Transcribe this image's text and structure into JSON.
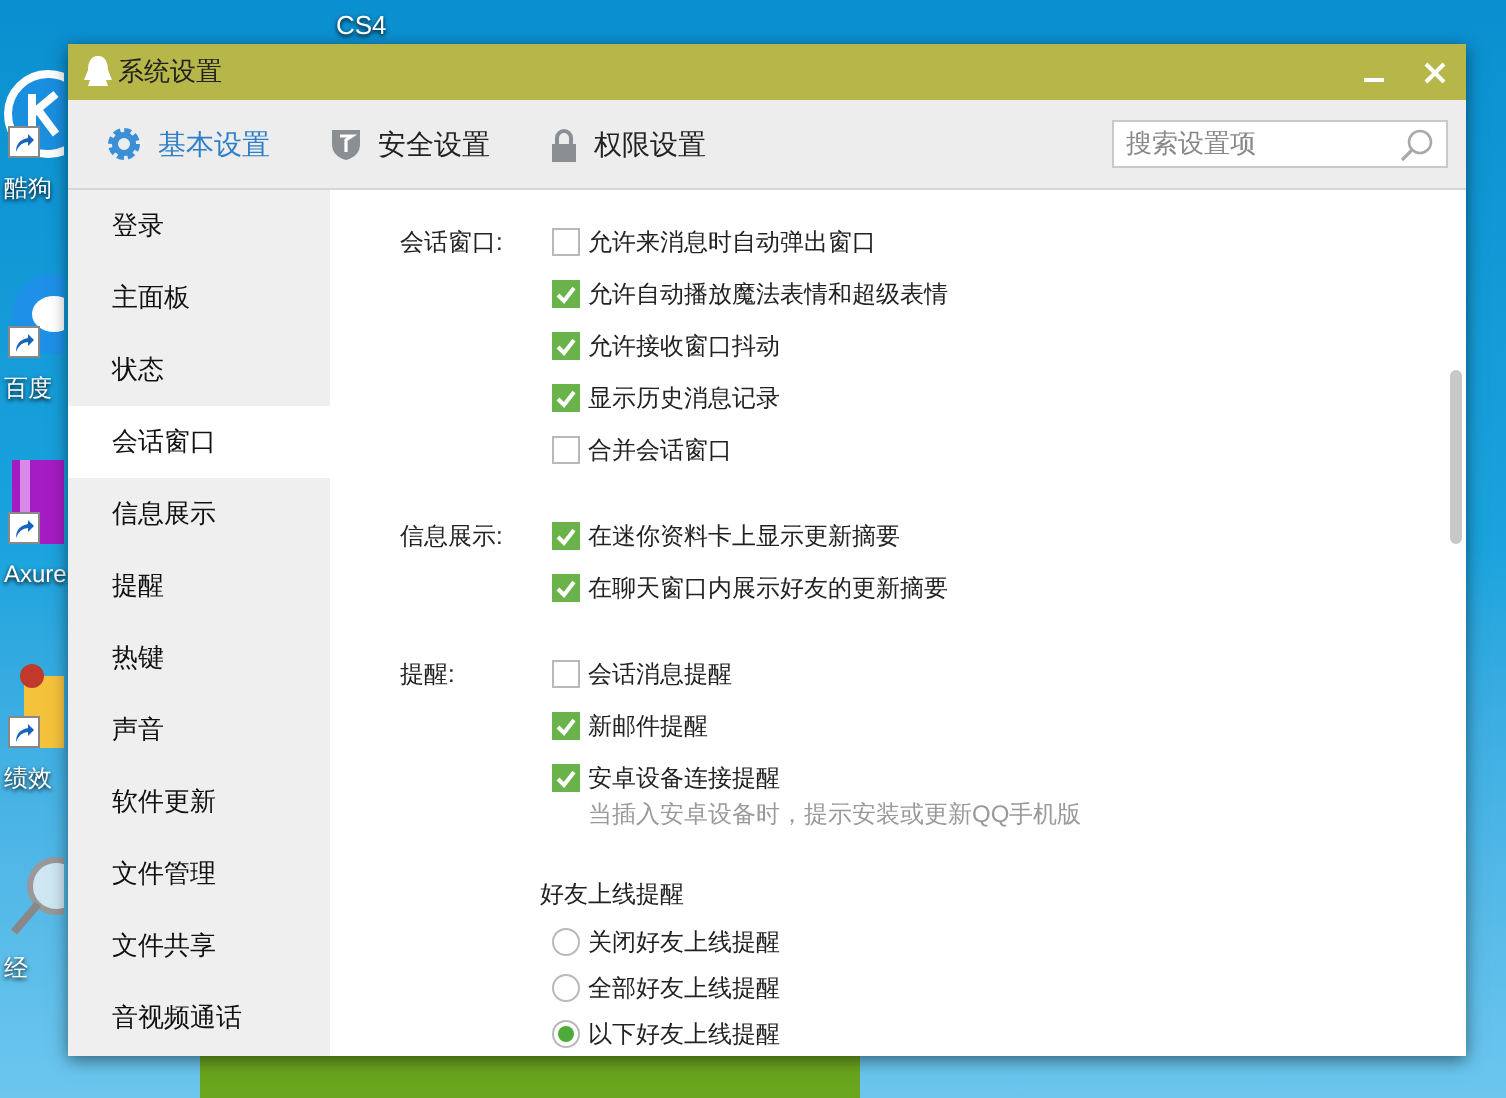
{
  "desktop": {
    "top_labels": [
      {
        "label": "CS4"
      }
    ],
    "icons": [
      {
        "kind": "music",
        "label": "酷狗"
      },
      {
        "kind": "browser",
        "label": "百度"
      },
      {
        "kind": "axure",
        "label": "Axure"
      },
      {
        "kind": "folder",
        "label": "绩效"
      },
      {
        "kind": "search",
        "label": "经"
      }
    ]
  },
  "window": {
    "title": "系统设置"
  },
  "tabs": [
    {
      "label": "基本设置",
      "selected": true
    },
    {
      "label": "安全设置",
      "selected": false
    },
    {
      "label": "权限设置",
      "selected": false
    }
  ],
  "search": {
    "placeholder": "搜索设置项"
  },
  "sidebar": {
    "items": [
      {
        "label": "登录",
        "selected": false
      },
      {
        "label": "主面板",
        "selected": false
      },
      {
        "label": "状态",
        "selected": false
      },
      {
        "label": "会话窗口",
        "selected": true
      },
      {
        "label": "信息展示",
        "selected": false
      },
      {
        "label": "提醒",
        "selected": false
      },
      {
        "label": "热键",
        "selected": false
      },
      {
        "label": "声音",
        "selected": false
      },
      {
        "label": "软件更新",
        "selected": false
      },
      {
        "label": "文件管理",
        "selected": false
      },
      {
        "label": "文件共享",
        "selected": false
      },
      {
        "label": "音视频通话",
        "selected": false
      }
    ]
  },
  "sections": [
    {
      "label": "会话窗口:",
      "options": [
        {
          "kind": "checkbox",
          "label": "允许来消息时自动弹出窗口",
          "checked": false
        },
        {
          "kind": "checkbox",
          "label": "允许自动播放魔法表情和超级表情",
          "checked": true
        },
        {
          "kind": "checkbox",
          "label": "允许接收窗口抖动",
          "checked": true
        },
        {
          "kind": "checkbox",
          "label": "显示历史消息记录",
          "checked": true
        },
        {
          "kind": "checkbox",
          "label": "合并会话窗口",
          "checked": false
        }
      ]
    },
    {
      "label": "信息展示:",
      "options": [
        {
          "kind": "checkbox",
          "label": "在迷你资料卡上显示更新摘要",
          "checked": true
        },
        {
          "kind": "checkbox",
          "label": "在聊天窗口内展示好友的更新摘要",
          "checked": true
        }
      ]
    },
    {
      "label": "提醒:",
      "options": [
        {
          "kind": "checkbox",
          "label": "会话消息提醒",
          "checked": false
        },
        {
          "kind": "checkbox",
          "label": "新邮件提醒",
          "checked": true
        },
        {
          "kind": "checkbox",
          "label": "安卓设备连接提醒",
          "checked": true
        },
        {
          "kind": "note",
          "label": "当插入安卓设备时，提示安装或更新QQ手机版"
        },
        {
          "kind": "heading",
          "label": "好友上线提醒"
        },
        {
          "kind": "radio",
          "label": "关闭好友上线提醒",
          "selected": false
        },
        {
          "kind": "radio",
          "label": "全部好友上线提醒",
          "selected": false
        },
        {
          "kind": "radio",
          "label": "以下好友上线提醒",
          "selected": true
        }
      ]
    }
  ]
}
